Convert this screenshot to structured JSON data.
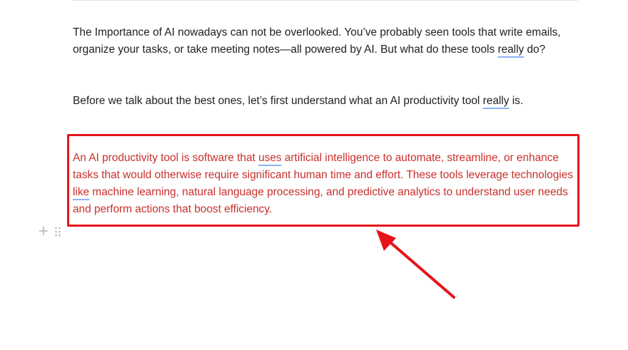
{
  "document": {
    "paragraph1": {
      "part1": "The Importance of AI nowadays can not be overlooked.  You’ve probably seen tools that write emails, organize your tasks, or take meeting notes—all powered by AI. But what do these tools ",
      "flag1": "really",
      "part2": " do?"
    },
    "paragraph2": {
      "part1": " Before we talk about the best ones, let’s first understand what an AI productivity tool ",
      "flag1": "really",
      "part2": " is."
    },
    "highlighted_paragraph": {
      "part1": "An AI productivity tool is software that ",
      "flag1": "uses",
      "part2": " artificial intelligence to automate, streamline, or enhance tasks that would otherwise require significant human time and effort. These tools leverage technologies ",
      "flag2": "like",
      "part3": " machine learning, natural language processing, and predictive analytics to understand user needs and perform actions that boost efficiency."
    }
  },
  "block_tools": {
    "add_icon": "plus-icon",
    "drag_icon": "drag-handle-icon"
  },
  "colors": {
    "annotation_red": "#e6141a",
    "highlight_text": "#c8302c",
    "spellcheck_underline": "#8ab4f8",
    "body_text": "#202124"
  }
}
